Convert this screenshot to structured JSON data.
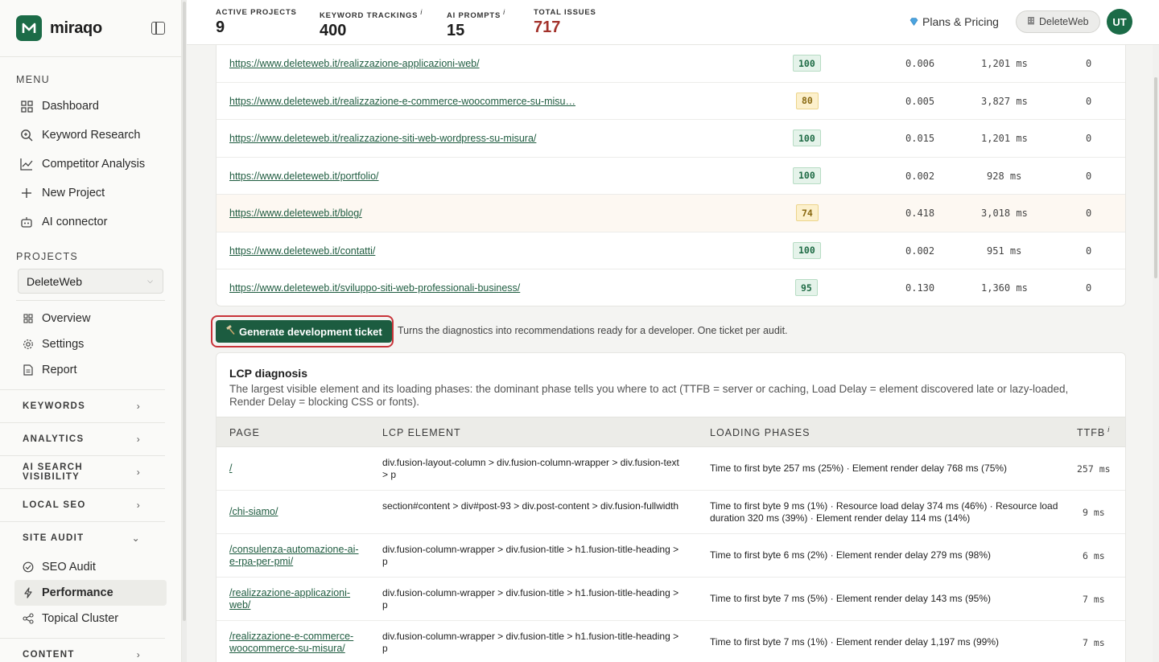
{
  "brand": {
    "name": "miraqo"
  },
  "sidebar": {
    "menu_title": "MENU",
    "menu": [
      {
        "label": "Dashboard",
        "icon": "grid-icon"
      },
      {
        "label": "Keyword Research",
        "icon": "search-icon"
      },
      {
        "label": "Competitor Analysis",
        "icon": "line-chart-icon"
      },
      {
        "label": "New Project",
        "icon": "plus-icon"
      },
      {
        "label": "AI connector",
        "icon": "robot-icon"
      }
    ],
    "projects_title": "PROJECTS",
    "project_selected": "DeleteWeb",
    "project_items": [
      {
        "label": "Overview",
        "icon": "grid-icon"
      },
      {
        "label": "Settings",
        "icon": "gear-icon"
      },
      {
        "label": "Report",
        "icon": "document-icon"
      }
    ],
    "groups": [
      {
        "label": "KEYWORDS"
      },
      {
        "label": "ANALYTICS"
      },
      {
        "label": "AI SEARCH VISIBILITY"
      },
      {
        "label": "LOCAL SEO"
      },
      {
        "label": "SITE AUDIT"
      }
    ],
    "site_audit_items": [
      {
        "label": "SEO Audit",
        "icon": "check-icon"
      },
      {
        "label": "Performance",
        "icon": "lightning-icon"
      },
      {
        "label": "Topical Cluster",
        "icon": "share-icon"
      }
    ],
    "content_group": "CONTENT"
  },
  "header": {
    "stats": [
      {
        "label": "ACTIVE PROJECTS",
        "value": "9",
        "info": ""
      },
      {
        "label": "KEYWORD TRACKINGS",
        "value": "400",
        "info": "i"
      },
      {
        "label": "AI PROMPTS",
        "value": "15",
        "info": "i"
      },
      {
        "label": "TOTAL ISSUES",
        "value": "717",
        "info": ""
      }
    ],
    "plans_label": "Plans & Pricing",
    "account_label": "DeleteWeb",
    "avatar_initials": "UT"
  },
  "url_table": {
    "rows": [
      {
        "url": "https://www.deleteweb.it/realizzazione-applicazioni-web/",
        "score": "100",
        "cls": "0.006",
        "time": "1,201 ms",
        "issues": "0"
      },
      {
        "url": "https://www.deleteweb.it/realizzazione-e-commerce-woocommerce-su-misu…",
        "score": "80",
        "cls": "0.005",
        "time": "3,827 ms",
        "issues": "0"
      },
      {
        "url": "https://www.deleteweb.it/realizzazione-siti-web-wordpress-su-misura/",
        "score": "100",
        "cls": "0.015",
        "time": "1,201 ms",
        "issues": "0"
      },
      {
        "url": "https://www.deleteweb.it/portfolio/",
        "score": "100",
        "cls": "0.002",
        "time": "928 ms",
        "issues": "0"
      },
      {
        "url": "https://www.deleteweb.it/blog/",
        "score": "74",
        "cls": "0.418",
        "time": "3,018 ms",
        "issues": "0"
      },
      {
        "url": "https://www.deleteweb.it/contatti/",
        "score": "100",
        "cls": "0.002",
        "time": "951 ms",
        "issues": "0"
      },
      {
        "url": "https://www.deleteweb.it/sviluppo-siti-web-professionali-business/",
        "score": "95",
        "cls": "0.130",
        "time": "1,360 ms",
        "issues": "0"
      }
    ]
  },
  "ticket": {
    "button_label": "Generate development ticket",
    "note": "Turns the diagnostics into recommendations ready for a developer. One ticket per audit."
  },
  "lcp": {
    "title": "LCP diagnosis",
    "description": "The largest visible element and its loading phases: the dominant phase tells you where to act (TTFB = server or caching, Load Delay = element discovered late or lazy-loaded, Render Delay = blocking CSS or fonts).",
    "columns": {
      "page": "PAGE",
      "element": "LCP ELEMENT",
      "phases": "LOADING PHASES",
      "ttfb": "TTFB",
      "ttfb_info": "i"
    },
    "rows": [
      {
        "page": "/",
        "element": "div.fusion-layout-column > div.fusion-column-wrapper > div.fusion-text > p",
        "phases": "Time to first byte 257 ms (25%) · Element render delay 768 ms (75%)",
        "ttfb": "257 ms"
      },
      {
        "page": "/chi-siamo/",
        "element": "section#content > div#post-93 > div.post-content > div.fusion-fullwidth",
        "phases": "Time to first byte 9 ms (1%) · Resource load delay 374 ms (46%) · Resource load duration 320 ms (39%) · Element render delay 114 ms (14%)",
        "ttfb": "9 ms"
      },
      {
        "page": "/consulenza-automazione-ai-e-rpa-per-pmi/",
        "element": "div.fusion-column-wrapper > div.fusion-title > h1.fusion-title-heading > p",
        "phases": "Time to first byte 6 ms (2%) · Element render delay 279 ms (98%)",
        "ttfb": "6 ms"
      },
      {
        "page": "/realizzazione-applicazioni-web/",
        "element": "div.fusion-column-wrapper > div.fusion-title > h1.fusion-title-heading > p",
        "phases": "Time to first byte 7 ms (5%) · Element render delay 143 ms (95%)",
        "ttfb": "7 ms"
      },
      {
        "page": "/realizzazione-e-commerce-woocommerce-su-misura/",
        "element": "div.fusion-column-wrapper > div.fusion-title > h1.fusion-title-heading > p",
        "phases": "Time to first byte 7 ms (1%) · Element render delay 1,197 ms (99%)",
        "ttfb": "7 ms"
      }
    ]
  },
  "colors": {
    "brand": "#1b6b47",
    "issues": "#a3322b",
    "highlight_ring": "#c8343a"
  }
}
